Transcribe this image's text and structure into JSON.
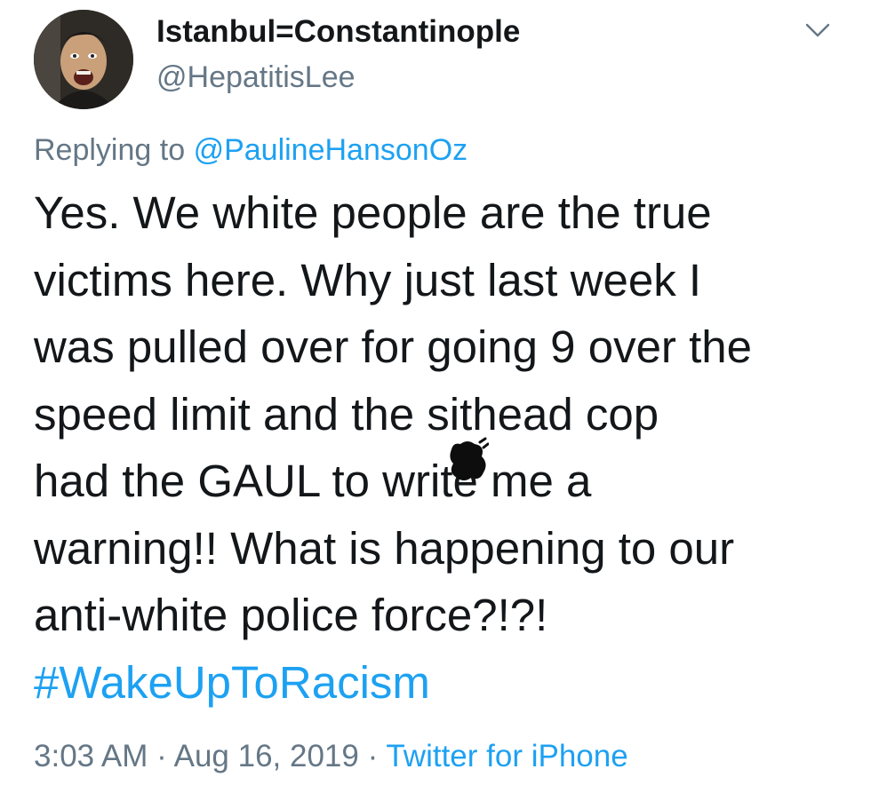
{
  "header": {
    "display_name": "Istanbul=Constantinople",
    "handle": "@HepatitisLee",
    "menu_icon": "chevron-down-icon"
  },
  "reply": {
    "prefix": "Replying to",
    "mention": "@PaulineHansonOz"
  },
  "tweet": {
    "lines": [
      "Yes. We white people are the true",
      "victims here. Why just last week I",
      "was pulled over for going 9 over the",
      "had the GAUL to write me a",
      "warning!! What is happening to our",
      "anti-white police force?!?!"
    ],
    "line4_before": "speed limit and the s",
    "line4_after": "ithead cop",
    "hashtag": "#WakeUpToRacism"
  },
  "meta": {
    "time": "3:03 AM",
    "date": "Aug 16, 2019",
    "separator": "·",
    "source": "Twitter for iPhone"
  },
  "colors": {
    "link": "#1da1f2",
    "secondary": "#657786",
    "text": "#14171a"
  }
}
